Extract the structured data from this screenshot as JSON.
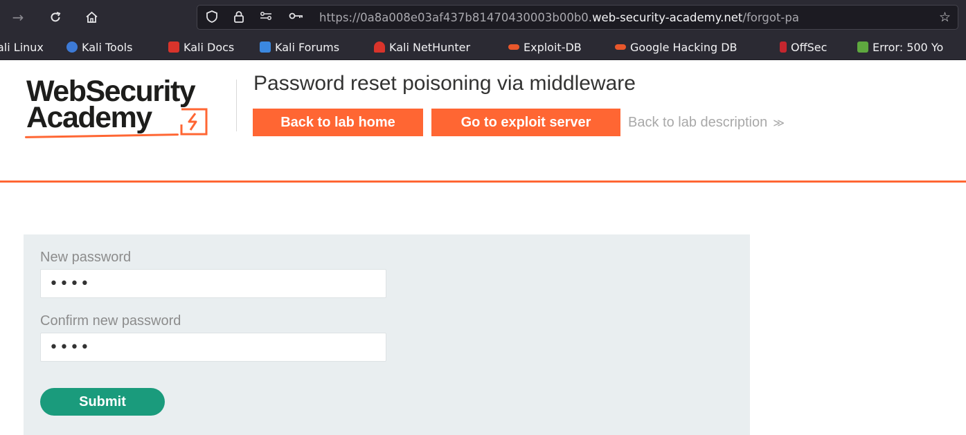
{
  "browser": {
    "url_prefix": "https://0a8a008e03af437b81470430003b00b0.",
    "url_domain": "web-security-academy.net",
    "url_suffix": "/forgot-pa",
    "bookmarks": [
      {
        "label": "ali Linux",
        "icon": "kali-linux-icon",
        "color": "#2b2a33"
      },
      {
        "label": "Kali Tools",
        "icon": "kali-tools-icon",
        "color": "#3d7ad6"
      },
      {
        "label": "Kali Docs",
        "icon": "kali-docs-icon",
        "color": "#d9342b"
      },
      {
        "label": "Kali Forums",
        "icon": "kali-forums-icon",
        "color": "#3b88e0"
      },
      {
        "label": "Kali NetHunter",
        "icon": "kali-nethunter-icon",
        "color": "#d9342b"
      },
      {
        "label": "Exploit-DB",
        "icon": "exploit-db-icon",
        "color": "#e8572b"
      },
      {
        "label": "Google Hacking DB",
        "icon": "google-hacking-db-icon",
        "color": "#e8572b"
      },
      {
        "label": "OffSec",
        "icon": "offsec-icon",
        "color": "#c4262e"
      },
      {
        "label": "Error: 500 Yo",
        "icon": "error-500-icon",
        "color": "#5ea83f"
      }
    ]
  },
  "header": {
    "logo_line1": "WebSecurity",
    "logo_line2": "Academy",
    "lab_title": "Password reset poisoning via middleware",
    "back_home_label": "Back to lab home",
    "exploit_server_label": "Go to exploit server",
    "back_description_label": "Back to lab description",
    "back_description_chevron": "≫"
  },
  "form": {
    "new_password_label": "New password",
    "new_password_value": "test",
    "confirm_password_label": "Confirm new password",
    "confirm_password_value": "test",
    "submit_label": "Submit"
  },
  "colors": {
    "accent": "#ff6633",
    "submit": "#1a9b7c",
    "panel": "#e9eef0"
  }
}
